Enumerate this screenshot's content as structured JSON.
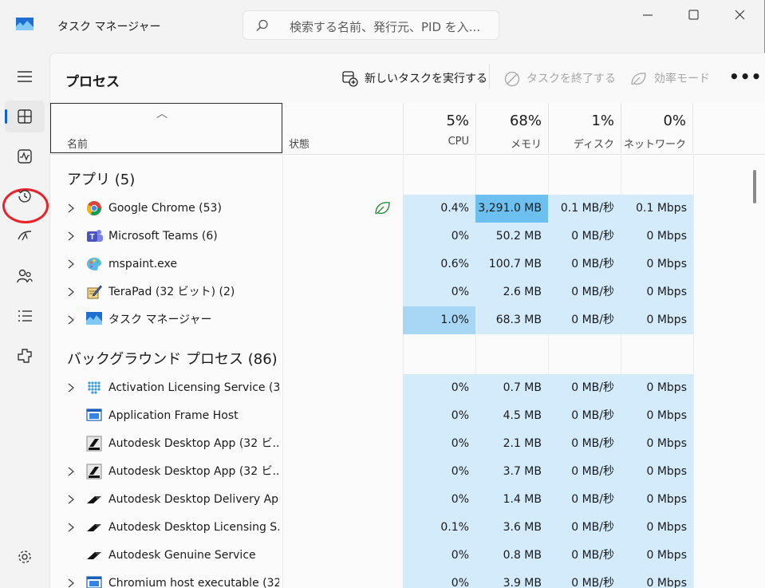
{
  "window": {
    "title": "タスク マネージャー",
    "search_placeholder": "検索する名前、発行元、PID を入..."
  },
  "nav": {
    "items": [
      {
        "id": "menu",
        "icon": "hamburger-icon"
      },
      {
        "id": "processes",
        "icon": "processes-icon",
        "active": true
      },
      {
        "id": "performance",
        "icon": "performance-icon",
        "highlighted": true
      },
      {
        "id": "app-history",
        "icon": "history-icon"
      },
      {
        "id": "startup",
        "icon": "startup-icon"
      },
      {
        "id": "users",
        "icon": "users-icon"
      },
      {
        "id": "details",
        "icon": "details-list-icon"
      },
      {
        "id": "services",
        "icon": "services-icon"
      },
      {
        "id": "settings",
        "icon": "gear-icon"
      }
    ]
  },
  "toolbar": {
    "page_title": "プロセス",
    "run_new_task": "新しいタスクを実行する",
    "end_task": "タスクを終了する",
    "efficiency_mode": "効率モード",
    "more": "•••"
  },
  "columns": {
    "name": "名前",
    "status": "状態",
    "cpu": {
      "pct": "5%",
      "label": "CPU"
    },
    "memory": {
      "pct": "68%",
      "label": "メモリ"
    },
    "disk": {
      "pct": "1%",
      "label": "ディスク"
    },
    "network": {
      "pct": "0%",
      "label": "ネットワーク"
    }
  },
  "groups": {
    "apps": "アプリ (5)",
    "background": "バックグラウンド プロセス (86)"
  },
  "apps": [
    {
      "name": "Google Chrome (53)",
      "icon": "chrome-icon",
      "expand": true,
      "status_icon": "leaf-icon",
      "cpu": "0.4%",
      "mem": "3,291.0 MB",
      "disk": "0.1 MB/秒",
      "net": "0.1 Mbps"
    },
    {
      "name": "Microsoft Teams (6)",
      "icon": "teams-icon",
      "expand": true,
      "cpu": "0%",
      "mem": "50.2 MB",
      "disk": "0 MB/秒",
      "net": "0 Mbps"
    },
    {
      "name": "mspaint.exe",
      "icon": "paint-icon",
      "expand": true,
      "cpu": "0.6%",
      "mem": "100.7 MB",
      "disk": "0 MB/秒",
      "net": "0 Mbps"
    },
    {
      "name": "TeraPad (32 ビット) (2)",
      "icon": "terapad-icon",
      "expand": true,
      "cpu": "0%",
      "mem": "2.6 MB",
      "disk": "0 MB/秒",
      "net": "0 Mbps"
    },
    {
      "name": "タスク マネージャー",
      "icon": "taskmgr-icon",
      "expand": true,
      "cpu": "1.0%",
      "mem": "68.3 MB",
      "disk": "0 MB/秒",
      "net": "0 Mbps"
    }
  ],
  "background": [
    {
      "name": "Activation Licensing Service (3...",
      "icon": "dots-icon",
      "expand": true,
      "cpu": "0%",
      "mem": "0.7 MB",
      "disk": "0 MB/秒",
      "net": "0 Mbps"
    },
    {
      "name": "Application Frame Host",
      "icon": "window-icon",
      "expand": false,
      "cpu": "0%",
      "mem": "4.5 MB",
      "disk": "0 MB/秒",
      "net": "0 Mbps"
    },
    {
      "name": "Autodesk Desktop App (32 ビ...",
      "icon": "autodesk-box-icon",
      "expand": false,
      "cpu": "0%",
      "mem": "2.1 MB",
      "disk": "0 MB/秒",
      "net": "0 Mbps"
    },
    {
      "name": "Autodesk Desktop App (32 ビ...",
      "icon": "autodesk-box-icon",
      "expand": true,
      "cpu": "0%",
      "mem": "3.7 MB",
      "disk": "0 MB/秒",
      "net": "0 Mbps"
    },
    {
      "name": "Autodesk Desktop Delivery Ap...",
      "icon": "autodesk-icon",
      "expand": true,
      "cpu": "0%",
      "mem": "1.4 MB",
      "disk": "0 MB/秒",
      "net": "0 Mbps"
    },
    {
      "name": "Autodesk Desktop Licensing S...",
      "icon": "autodesk-icon",
      "expand": true,
      "cpu": "0.1%",
      "mem": "3.6 MB",
      "disk": "0 MB/秒",
      "net": "0 Mbps"
    },
    {
      "name": "Autodesk Genuine Service",
      "icon": "autodesk-icon",
      "expand": false,
      "cpu": "0%",
      "mem": "0.8 MB",
      "disk": "0 MB/秒",
      "net": "0 Mbps"
    },
    {
      "name": "Chromium host executable (32...",
      "icon": "window-icon",
      "expand": true,
      "cpu": "0%",
      "mem": "3.9 MB",
      "disk": "0 MB/秒",
      "net": "0 Mbps"
    }
  ],
  "colors": {
    "heat_light": "#d3ebfb",
    "heat_mid": "#a8d6f5",
    "heat_strong": "#6bc0ef",
    "accent": "#0f62c9",
    "highlight_ring": "#e8232a"
  }
}
